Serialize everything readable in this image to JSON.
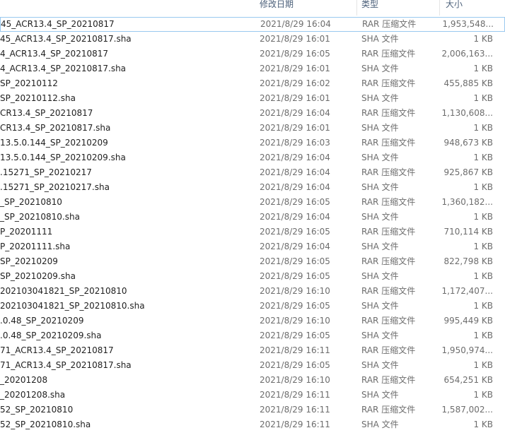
{
  "columns": {
    "date": "修改日期",
    "type": "类型",
    "size": "大小"
  },
  "rows": [
    {
      "name": "45_ACR13.4_SP_20210817",
      "date": "2021/8/29 16:04",
      "type": "RAR 压缩文件",
      "size": "1,953,548..."
    },
    {
      "name": "45_ACR13.4_SP_20210817.sha",
      "date": "2021/8/29 16:01",
      "type": "SHA 文件",
      "size": "1 KB"
    },
    {
      "name": "4_ACR13.4_SP_20210817",
      "date": "2021/8/29 16:05",
      "type": "RAR 压缩文件",
      "size": "2,006,163..."
    },
    {
      "name": "4_ACR13.4_SP_20210817.sha",
      "date": "2021/8/29 16:01",
      "type": "SHA 文件",
      "size": "1 KB"
    },
    {
      "name": "SP_20210112",
      "date": "2021/8/29 16:02",
      "type": "RAR 压缩文件",
      "size": "455,885 KB"
    },
    {
      "name": "SP_20210112.sha",
      "date": "2021/8/29 16:01",
      "type": "SHA 文件",
      "size": "1 KB"
    },
    {
      "name": "CR13.4_SP_20210817",
      "date": "2021/8/29 16:04",
      "type": "RAR 压缩文件",
      "size": "1,130,608..."
    },
    {
      "name": "CR13.4_SP_20210817.sha",
      "date": "2021/8/29 16:01",
      "type": "SHA 文件",
      "size": "1 KB"
    },
    {
      "name": "13.5.0.144_SP_20210209",
      "date": "2021/8/29 16:03",
      "type": "RAR 压缩文件",
      "size": "948,673 KB"
    },
    {
      "name": "13.5.0.144_SP_20210209.sha",
      "date": "2021/8/29 16:04",
      "type": "SHA 文件",
      "size": "1 KB"
    },
    {
      "name": ".15271_SP_20210217",
      "date": "2021/8/29 16:04",
      "type": "RAR 压缩文件",
      "size": "925,867 KB"
    },
    {
      "name": ".15271_SP_20210217.sha",
      "date": "2021/8/29 16:04",
      "type": "SHA 文件",
      "size": "1 KB"
    },
    {
      "name": "_SP_20210810",
      "date": "2021/8/29 16:05",
      "type": "RAR 压缩文件",
      "size": "1,360,182..."
    },
    {
      "name": "_SP_20210810.sha",
      "date": "2021/8/29 16:04",
      "type": "SHA 文件",
      "size": "1 KB"
    },
    {
      "name": "P_20201111",
      "date": "2021/8/29 16:05",
      "type": "RAR 压缩文件",
      "size": "710,114 KB"
    },
    {
      "name": "P_20201111.sha",
      "date": "2021/8/29 16:04",
      "type": "SHA 文件",
      "size": "1 KB"
    },
    {
      "name": "SP_20210209",
      "date": "2021/8/29 16:05",
      "type": "RAR 压缩文件",
      "size": "822,798 KB"
    },
    {
      "name": "SP_20210209.sha",
      "date": "2021/8/29 16:05",
      "type": "SHA 文件",
      "size": "1 KB"
    },
    {
      "name": "202103041821_SP_20210810",
      "date": "2021/8/29 16:10",
      "type": "RAR 压缩文件",
      "size": "1,172,407..."
    },
    {
      "name": "202103041821_SP_20210810.sha",
      "date": "2021/8/29 16:05",
      "type": "SHA 文件",
      "size": "1 KB"
    },
    {
      "name": ".0.48_SP_20210209",
      "date": "2021/8/29 16:10",
      "type": "RAR 压缩文件",
      "size": "995,449 KB"
    },
    {
      "name": ".0.48_SP_20210209.sha",
      "date": "2021/8/29 16:05",
      "type": "SHA 文件",
      "size": "1 KB"
    },
    {
      "name": "71_ACR13.4_SP_20210817",
      "date": "2021/8/29 16:11",
      "type": "RAR 压缩文件",
      "size": "1,950,974..."
    },
    {
      "name": "71_ACR13.4_SP_20210817.sha",
      "date": "2021/8/29 16:05",
      "type": "SHA 文件",
      "size": "1 KB"
    },
    {
      "name": "_20201208",
      "date": "2021/8/29 16:10",
      "type": "RAR 压缩文件",
      "size": "654,251 KB"
    },
    {
      "name": "_20201208.sha",
      "date": "2021/8/29 16:11",
      "type": "SHA 文件",
      "size": "1 KB"
    },
    {
      "name": "52_SP_20210810",
      "date": "2021/8/29 16:11",
      "type": "RAR 压缩文件",
      "size": "1,587,002..."
    },
    {
      "name": "52_SP_20210810.sha",
      "date": "2021/8/29 16:11",
      "type": "SHA 文件",
      "size": "1 KB"
    }
  ]
}
